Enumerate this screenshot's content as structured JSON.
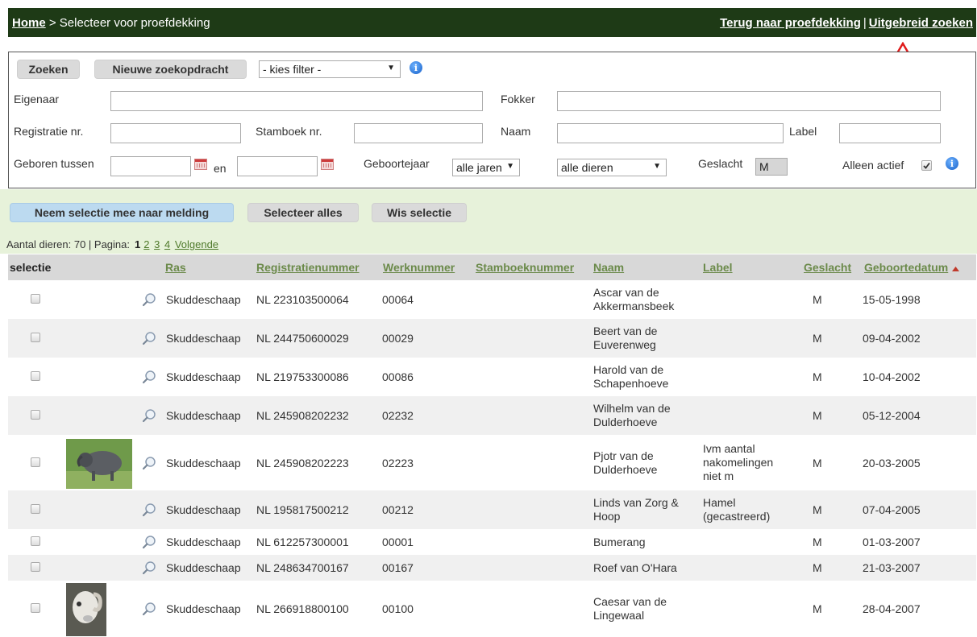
{
  "topbar": {
    "home": "Home",
    "crumb": " > Selecteer voor proefdekking",
    "back_link": "Terug naar proefdekking",
    "separator": "|",
    "advanced_link": "Uitgebreid zoeken"
  },
  "search": {
    "search_button": "Zoeken",
    "new_search_button": "Nieuwe zoekopdracht",
    "filter_select": "- kies filter -",
    "owner_label": "Eigenaar",
    "breeder_label": "Fokker",
    "registration_label": "Registratie nr.",
    "studbook_label": "Stamboek nr.",
    "name_label": "Naam",
    "label_label": "Label",
    "born_between_label": "Geboren tussen",
    "and_label": "en",
    "birth_year_label": "Geboortejaar",
    "birth_year_value": "alle jaren",
    "animals_value": "alle dieren",
    "gender_label": "Geslacht",
    "gender_value": "M",
    "active_only_label": "Alleen actief"
  },
  "actions": {
    "take_selection": "Neem selectie mee naar melding",
    "select_all": "Selecteer alles",
    "clear_selection": "Wis selectie"
  },
  "paging": {
    "count_text": "Aantal dieren: 70 | Pagina:",
    "current_page": "1",
    "pages": [
      "2",
      "3",
      "4"
    ],
    "next": "Volgende"
  },
  "table": {
    "headers": {
      "selection": "selectie",
      "breed": "Ras",
      "registration_number": "Registratienummer",
      "work_number": "Werknummer",
      "studbook_number": "Stamboeknummer",
      "name": "Naam",
      "label": "Label",
      "gender": "Geslacht",
      "birth_date": "Geboortedatum"
    },
    "rows": [
      {
        "breed": "Skuddeschaap",
        "reg": "NL 223103500064",
        "work": "00064",
        "name": "Ascar van de Akkermansbeek",
        "label": "",
        "gender": "M",
        "birth": "15-05-1998"
      },
      {
        "breed": "Skuddeschaap",
        "reg": "NL 244750600029",
        "work": "00029",
        "name": "Beert van de Euverenweg",
        "label": "",
        "gender": "M",
        "birth": "09-04-2002"
      },
      {
        "breed": "Skuddeschaap",
        "reg": "NL 219753300086",
        "work": "00086",
        "name": "Harold van de Schapenhoeve",
        "label": "",
        "gender": "M",
        "birth": "10-04-2002"
      },
      {
        "breed": "Skuddeschaap",
        "reg": "NL 245908202232",
        "work": "02232",
        "name": "Wilhelm van de Dulderhoeve",
        "label": "",
        "gender": "M",
        "birth": "05-12-2004"
      },
      {
        "breed": "Skuddeschaap",
        "reg": "NL 245908202223",
        "work": "02223",
        "name": "Pjotr van de Dulderhoeve",
        "label": "Ivm aantal nakomelingen niet m",
        "gender": "M",
        "birth": "20-03-2005"
      },
      {
        "breed": "Skuddeschaap",
        "reg": "NL 195817500212",
        "work": "00212",
        "name": "Linds van Zorg & Hoop",
        "label": "Hamel (gecastreerd)",
        "gender": "M",
        "birth": "07-04-2005"
      },
      {
        "breed": "Skuddeschaap",
        "reg": "NL 612257300001",
        "work": "00001",
        "name": "Bumerang",
        "label": "",
        "gender": "M",
        "birth": "01-03-2007"
      },
      {
        "breed": "Skuddeschaap",
        "reg": "NL 248634700167",
        "work": "00167",
        "name": "Roef van O'Hara",
        "label": "",
        "gender": "M",
        "birth": "21-03-2007"
      },
      {
        "breed": "Skuddeschaap",
        "reg": "NL 266918800100",
        "work": "00100",
        "name": "Caesar van de Lingewaal",
        "label": "",
        "gender": "M",
        "birth": "28-04-2007"
      }
    ]
  }
}
